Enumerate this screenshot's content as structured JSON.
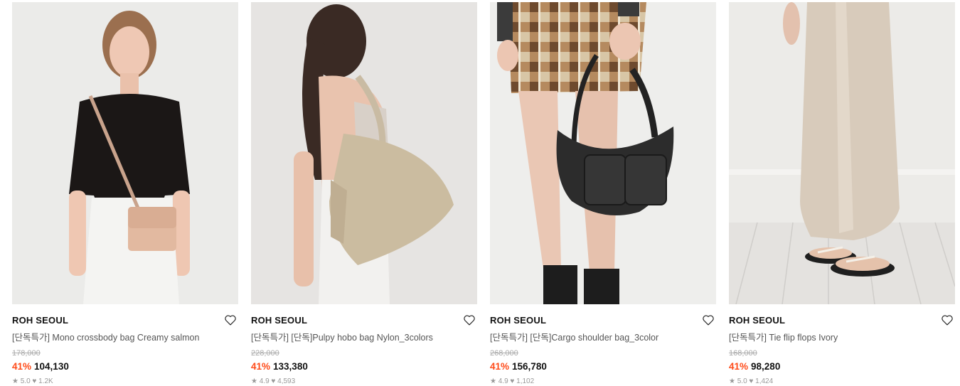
{
  "products": [
    {
      "brand": "ROH SEOUL",
      "title": "[단독특가] Mono crossbody bag Creamy salmon",
      "original_price": "178,000",
      "discount": "41%",
      "price": "104,130",
      "rating_text": "★ 5.0  ♥ 1.2K",
      "wishlist_icon": "heart-outline-icon"
    },
    {
      "brand": "ROH SEOUL",
      "title": "[단독특가] [단독]Pulpy hobo bag Nylon_3colors",
      "original_price": "228,000",
      "discount": "41%",
      "price": "133,380",
      "rating_text": "★ 4.9  ♥ 4,593",
      "wishlist_icon": "heart-outline-icon"
    },
    {
      "brand": "ROH SEOUL",
      "title": "[단독특가] [단독]Cargo shoulder bag_3color",
      "original_price": "268,000",
      "discount": "41%",
      "price": "156,780",
      "rating_text": "★ 4.9  ♥ 1,102",
      "wishlist_icon": "heart-outline-icon"
    },
    {
      "brand": "ROH SEOUL",
      "title": "[단독특가] Tie flip flops Ivory",
      "original_price": "168,000",
      "discount": "41%",
      "price": "98,280",
      "rating_text": "★ 5.0  ♥ 1,424",
      "wishlist_icon": "heart-outline-icon"
    }
  ],
  "colors": {
    "discount": "#ff4b19",
    "brand_text": "#111111",
    "title_text": "#555555",
    "strikethrough": "#aaaaaa"
  }
}
